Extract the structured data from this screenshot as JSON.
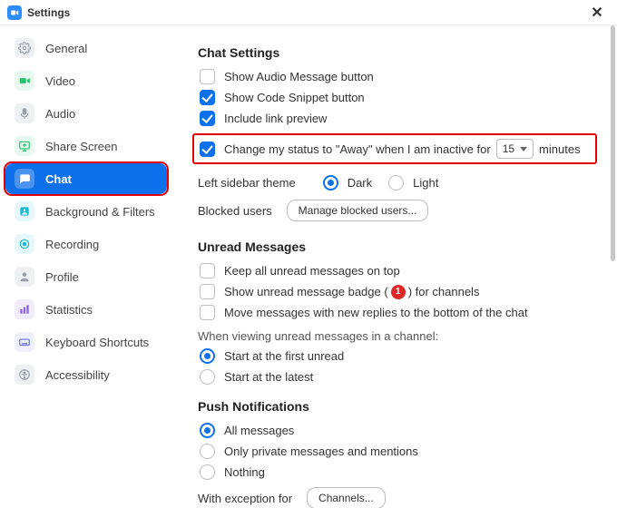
{
  "window": {
    "title": "Settings"
  },
  "sidebar": {
    "items": [
      {
        "label": "General"
      },
      {
        "label": "Video"
      },
      {
        "label": "Audio"
      },
      {
        "label": "Share Screen"
      },
      {
        "label": "Chat"
      },
      {
        "label": "Background & Filters"
      },
      {
        "label": "Recording"
      },
      {
        "label": "Profile"
      },
      {
        "label": "Statistics"
      },
      {
        "label": "Keyboard Shortcuts"
      },
      {
        "label": "Accessibility"
      }
    ]
  },
  "chat": {
    "section_title": "Chat Settings",
    "show_audio_msg": "Show Audio Message button",
    "show_code_snip": "Show Code Snippet button",
    "include_link_preview": "Include link preview",
    "away_prefix": "Change my status to \"Away\" when I am inactive for",
    "away_value": "15",
    "away_suffix": "minutes",
    "sidebar_theme_label": "Left sidebar theme",
    "theme_dark": "Dark",
    "theme_light": "Light",
    "blocked_label": "Blocked users",
    "blocked_btn": "Manage blocked users..."
  },
  "unread": {
    "section_title": "Unread Messages",
    "keep_top": "Keep all unread messages on top",
    "show_badge_pre": "Show unread message badge (",
    "show_badge_num": "1",
    "show_badge_post": ") for channels",
    "move_bottom": "Move messages with new replies to the bottom of the chat",
    "viewing_note": "When viewing unread messages in a channel:",
    "start_first": "Start at the first unread",
    "start_latest": "Start at the latest"
  },
  "push": {
    "section_title": "Push Notifications",
    "all": "All messages",
    "private_only": "Only private messages and mentions",
    "nothing": "Nothing",
    "exception_label": "With exception for",
    "exception_btn": "Channels..."
  }
}
